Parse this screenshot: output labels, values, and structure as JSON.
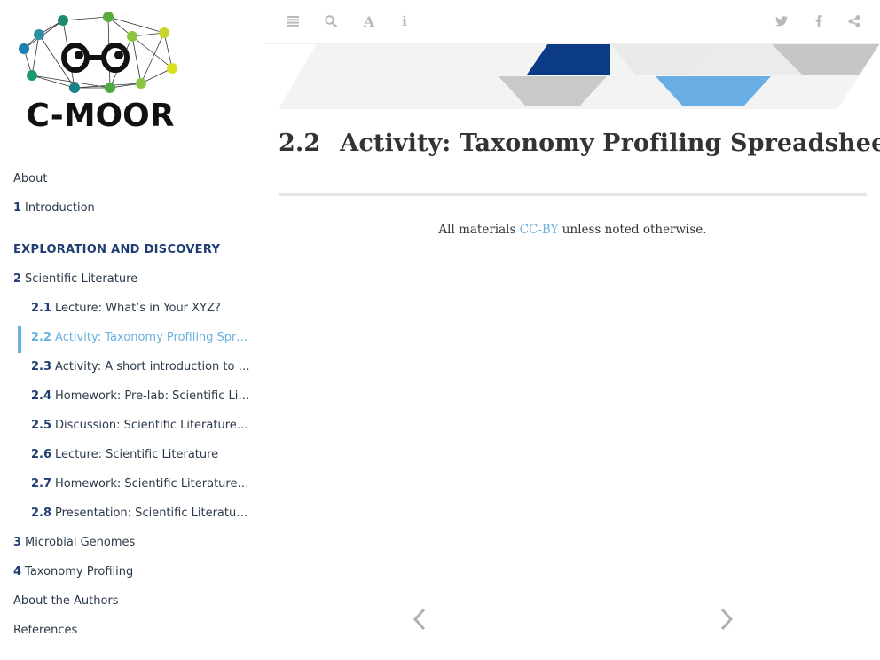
{
  "logo": {
    "text": "C-MOOR"
  },
  "toc": [
    {
      "num": "",
      "label": "About",
      "level": 0
    },
    {
      "num": "1",
      "label": "Introduction",
      "level": 0
    },
    {
      "num": "",
      "label": "EXPLORATION AND DISCOVERY",
      "level": 0,
      "part": true
    },
    {
      "num": "2",
      "label": "Scientific Literature",
      "level": 0
    },
    {
      "num": "2.1",
      "label": "Lecture: What’s in Your XYZ?",
      "level": 1
    },
    {
      "num": "2.2",
      "label": "Activity: Taxonomy Profiling Spre…",
      "level": 1,
      "active": true
    },
    {
      "num": "2.3",
      "label": "Activity: A short introduction to G…",
      "level": 1
    },
    {
      "num": "2.4",
      "label": "Homework: Pre-lab: Scientific Lite…",
      "level": 1
    },
    {
      "num": "2.5",
      "label": "Discussion: Scientific Literature P…",
      "level": 1
    },
    {
      "num": "2.6",
      "label": "Lecture: Scientific Literature",
      "level": 1
    },
    {
      "num": "2.7",
      "label": "Homework: Scientific Literature A…",
      "level": 1
    },
    {
      "num": "2.8",
      "label": "Presentation: Scientific Literature…",
      "level": 1
    },
    {
      "num": "3",
      "label": "Microbial Genomes",
      "level": 0
    },
    {
      "num": "4",
      "label": "Taxonomy Profiling",
      "level": 0
    },
    {
      "num": "",
      "label": "About the Authors",
      "level": 0
    },
    {
      "num": "",
      "label": "References",
      "level": 0
    }
  ],
  "toolbar": {
    "left_icons": [
      "menu-icon",
      "search-icon",
      "font-icon",
      "info-icon"
    ],
    "right_icons": [
      "twitter-icon",
      "facebook-icon",
      "share-icon"
    ]
  },
  "page": {
    "section_number": "2.2",
    "title": "Activity: Taxonomy Profiling Spreadsheet",
    "license_prefix": "All materials ",
    "license_link": "CC-BY",
    "license_suffix": " unless noted otherwise."
  },
  "nav": {
    "prev_icon": "chevron-left-icon",
    "next_icon": "chevron-right-icon"
  },
  "colors": {
    "accent": "#6ab0de",
    "navy": "#1f3d73",
    "banner_dark": "#0b3a86",
    "banner_light": "#6aaee6",
    "text": "#333333"
  }
}
